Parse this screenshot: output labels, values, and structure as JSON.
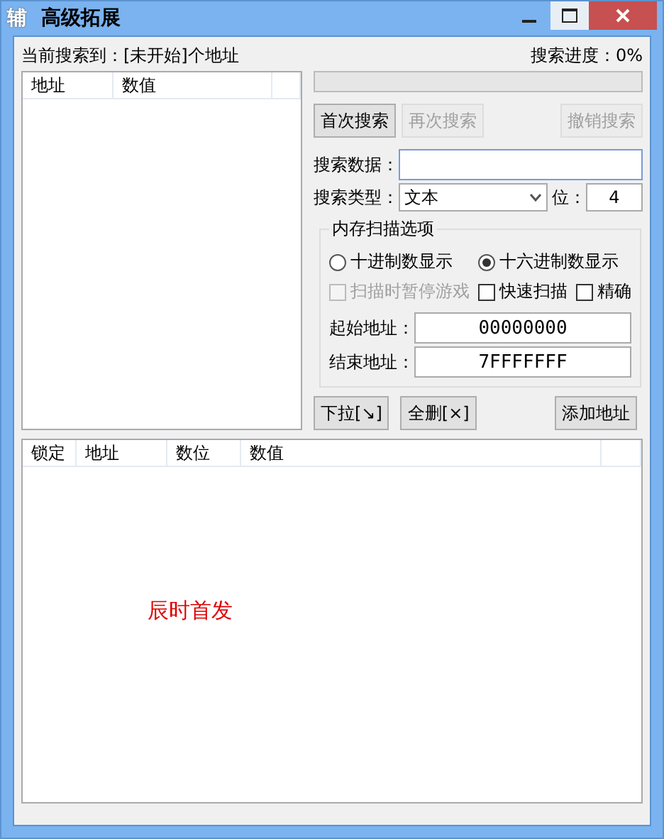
{
  "window": {
    "icon_char": "辅",
    "title": "高级拓展"
  },
  "status": {
    "found": "当前搜索到：[未开始]个地址",
    "progress_label": "搜索进度：0%",
    "level": 0
  },
  "result_table": {
    "columns": [
      "地址",
      "数值"
    ]
  },
  "search_buttons": [
    {
      "label": "首次搜索",
      "disabled": false
    },
    {
      "label": "再次搜索",
      "disabled": true
    },
    {
      "label": "撤销搜索",
      "disabled": true
    }
  ],
  "search_data": {
    "label": "搜索数据："
  },
  "search_type": {
    "label": "搜索类型：",
    "value": "文本",
    "bits_label": "位：",
    "bits": "4"
  },
  "scan_options": {
    "title": "内存扫描选项",
    "radios": [
      {
        "label": "十进制数显示",
        "selected": false
      },
      {
        "label": "十六进制数显示",
        "selected": true
      }
    ],
    "checkboxes": [
      {
        "label": "扫描时暂停游戏",
        "checked": false,
        "disabled": true
      },
      {
        "label": "快速扫描",
        "checked": false,
        "disabled": false
      },
      {
        "label": "精确",
        "checked": false,
        "disabled": false
      }
    ],
    "start": {
      "label": "起始地址：",
      "value": "00000000"
    },
    "end": {
      "label": "结束地址：",
      "value": "7FFFFFFF"
    }
  },
  "action_buttons": [
    "下拉[↘]",
    "全删[×]",
    "添加地址"
  ],
  "lock_table": {
    "columns": [
      "锁定",
      "地址",
      "数位",
      "数值"
    ],
    "note": "辰时首发"
  }
}
